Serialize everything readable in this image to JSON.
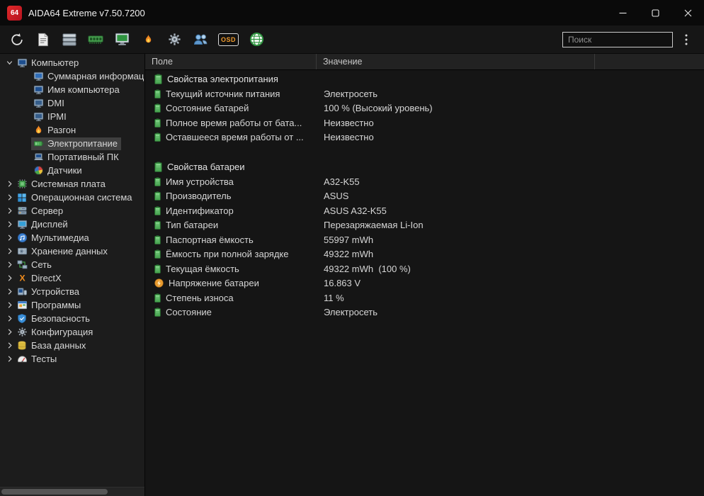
{
  "window": {
    "title": "AIDA64 Extreme v7.50.7200",
    "logo_text": "64"
  },
  "toolbar": {
    "buttons": [
      {
        "id": "refresh"
      },
      {
        "id": "report"
      },
      {
        "id": "summary"
      },
      {
        "id": "memory"
      },
      {
        "id": "video"
      },
      {
        "id": "overclock"
      },
      {
        "id": "settings"
      },
      {
        "id": "users"
      },
      {
        "id": "osd",
        "label": "OSD"
      },
      {
        "id": "web"
      }
    ],
    "search": {
      "placeholder": "Поиск"
    }
  },
  "sidebar": {
    "items": [
      {
        "label": "Компьютер",
        "icon": "computer",
        "level": 0,
        "chevron": "down",
        "selected": false
      },
      {
        "label": "Суммарная информация",
        "icon": "summary-page",
        "level": 1,
        "selected": false
      },
      {
        "label": "Имя компьютера",
        "icon": "computer-name",
        "level": 1,
        "selected": false
      },
      {
        "label": "DMI",
        "icon": "dmi",
        "level": 1,
        "selected": false
      },
      {
        "label": "IPMI",
        "icon": "ipmi",
        "level": 1,
        "selected": false
      },
      {
        "label": "Разгон",
        "icon": "overclock",
        "level": 1,
        "selected": false
      },
      {
        "label": "Электропитание",
        "icon": "power",
        "level": 1,
        "selected": true
      },
      {
        "label": "Портативный ПК",
        "icon": "laptop",
        "level": 1,
        "selected": false
      },
      {
        "label": "Датчики",
        "icon": "sensors",
        "level": 1,
        "selected": false
      },
      {
        "label": "Системная плата",
        "icon": "motherboard",
        "level": 0,
        "chevron": "right",
        "selected": false
      },
      {
        "label": "Операционная система",
        "icon": "os",
        "level": 0,
        "chevron": "right",
        "selected": false
      },
      {
        "label": "Сервер",
        "icon": "server",
        "level": 0,
        "chevron": "right",
        "selected": false
      },
      {
        "label": "Дисплей",
        "icon": "display",
        "level": 0,
        "chevron": "right",
        "selected": false
      },
      {
        "label": "Мультимедиа",
        "icon": "multimedia",
        "level": 0,
        "chevron": "right",
        "selected": false
      },
      {
        "label": "Хранение данных",
        "icon": "storage",
        "level": 0,
        "chevron": "right",
        "selected": false
      },
      {
        "label": "Сеть",
        "icon": "network",
        "level": 0,
        "chevron": "right",
        "selected": false
      },
      {
        "label": "DirectX",
        "icon": "directx",
        "level": 0,
        "chevron": "right",
        "selected": false
      },
      {
        "label": "Устройства",
        "icon": "devices",
        "level": 0,
        "chevron": "right",
        "selected": false
      },
      {
        "label": "Программы",
        "icon": "programs",
        "level": 0,
        "chevron": "right",
        "selected": false
      },
      {
        "label": "Безопасность",
        "icon": "security",
        "level": 0,
        "chevron": "right",
        "selected": false
      },
      {
        "label": "Конфигурация",
        "icon": "config",
        "level": 0,
        "chevron": "right",
        "selected": false
      },
      {
        "label": "База данных",
        "icon": "database",
        "level": 0,
        "chevron": "right",
        "selected": false
      },
      {
        "label": "Тесты",
        "icon": "benchmark",
        "level": 0,
        "chevron": "right",
        "selected": false
      }
    ]
  },
  "main": {
    "columns": [
      {
        "label": "Поле"
      },
      {
        "label": "Значение"
      }
    ],
    "sections": [
      {
        "title": "Свойства электропитания",
        "icon": "battery-section",
        "rows": [
          {
            "field": "Текущий источник питания",
            "value": "Электросеть",
            "icon": "battery"
          },
          {
            "field": "Состояние батарей",
            "value": "100 % (Высокий уровень)",
            "icon": "battery"
          },
          {
            "field": "Полное время работы от бата...",
            "value": "Неизвестно",
            "icon": "battery"
          },
          {
            "field": "Оставшееся время работы от ...",
            "value": "Неизвестно",
            "icon": "battery"
          }
        ]
      },
      {
        "title": "Свойства батареи",
        "icon": "battery-section",
        "rows": [
          {
            "field": "Имя устройства",
            "value": "A32-K55",
            "icon": "battery"
          },
          {
            "field": "Производитель",
            "value": "ASUS",
            "icon": "battery"
          },
          {
            "field": "Идентификатор",
            "value": "ASUS A32-K55",
            "icon": "battery"
          },
          {
            "field": "Тип батареи",
            "value": "Перезаряжаемая Li-Ion",
            "icon": "battery"
          },
          {
            "field": "Паспортная ёмкость",
            "value": "55997 mWh",
            "icon": "battery"
          },
          {
            "field": "Ёмкость при полной зарядке",
            "value": "49322 mWh",
            "icon": "battery"
          },
          {
            "field": "Текущая ёмкость",
            "value": "49322 mWh  (100 %)",
            "icon": "battery"
          },
          {
            "field": "Напряжение батареи",
            "value": "16.863 V",
            "icon": "voltage"
          },
          {
            "field": "Степень износа",
            "value": "11 %",
            "icon": "battery"
          },
          {
            "field": "Состояние",
            "value": "Электросеть",
            "icon": "battery"
          }
        ]
      }
    ]
  }
}
